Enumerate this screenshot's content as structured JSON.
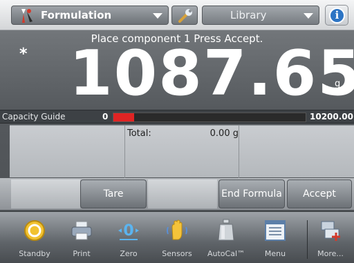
{
  "topbar": {
    "mode_label": "Formulation",
    "library_label": "Library",
    "info_glyph": "i"
  },
  "display": {
    "instruction": "Place component 1 Press Accept.",
    "stable_indicator": "*",
    "weight": "1087.65",
    "unit": "g"
  },
  "capacity_guide": {
    "label": "Capacity Guide",
    "min": "0",
    "max": "10200.00",
    "fill_fraction": 0.107
  },
  "panel": {
    "total_label": "Total:",
    "total_value": "0.00 g"
  },
  "actions": {
    "tare": "Tare",
    "end_formula": "End Formula",
    "accept": "Accept"
  },
  "navbar": {
    "items": [
      {
        "label": "Standby",
        "icon": "standby-icon"
      },
      {
        "label": "Print",
        "icon": "printer-icon"
      },
      {
        "label": "Zero",
        "icon": "zero-icon"
      },
      {
        "label": "Sensors",
        "icon": "hand-sensor-icon"
      },
      {
        "label": "AutoCal™",
        "icon": "calibration-weight-icon"
      },
      {
        "label": "Menu",
        "icon": "menu-icon"
      },
      {
        "label": "More...",
        "icon": "more-icon"
      }
    ]
  },
  "colors": {
    "capacity_fill": "#e02424",
    "info_blue": "#2c74c4"
  }
}
